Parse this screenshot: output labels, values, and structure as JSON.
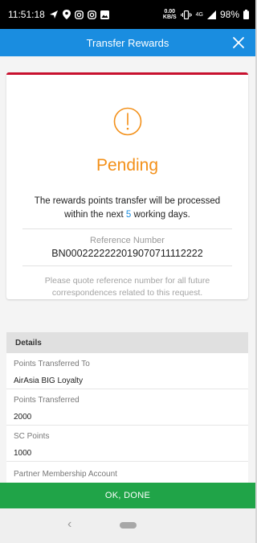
{
  "status_bar": {
    "time": "11:51:18",
    "left_icons": [
      "send-icon",
      "location-icon",
      "instagram-icon",
      "instagram-icon",
      "gallery-icon"
    ],
    "data_rate_top": "0.00",
    "data_rate_bottom": "KB/S",
    "network": "4G",
    "battery": "98%"
  },
  "app_bar": {
    "title": "Transfer Rewards",
    "close_icon": "close-icon",
    "background": "#1a8de0"
  },
  "result_card": {
    "icon": "exclamation-circle-icon",
    "status": "Pending",
    "status_color": "#f39019",
    "accent_color": "#c8102e",
    "message_before": "The rewards points transfer will be processed within the next ",
    "message_days": "5",
    "message_after": " working days.",
    "reference_label": "Reference Number",
    "reference_number": "BN0002222222019070711112222",
    "quote_note": "Please quote reference number for all future correspondences related to this request."
  },
  "details": {
    "header": "Details",
    "rows": [
      {
        "label": "Points Transferred To",
        "value": "AirAsia BIG Loyalty"
      },
      {
        "label": "Points Transferred",
        "value": "2000"
      },
      {
        "label": "SC Points",
        "value": "1000"
      },
      {
        "label": "Partner Membership Account",
        "value": ""
      }
    ]
  },
  "done_button": {
    "label": "OK, DONE",
    "color": "#20a448"
  },
  "nav_bar": {
    "back_icon": "back-chevron-icon",
    "home_icon": "home-pill-icon"
  }
}
